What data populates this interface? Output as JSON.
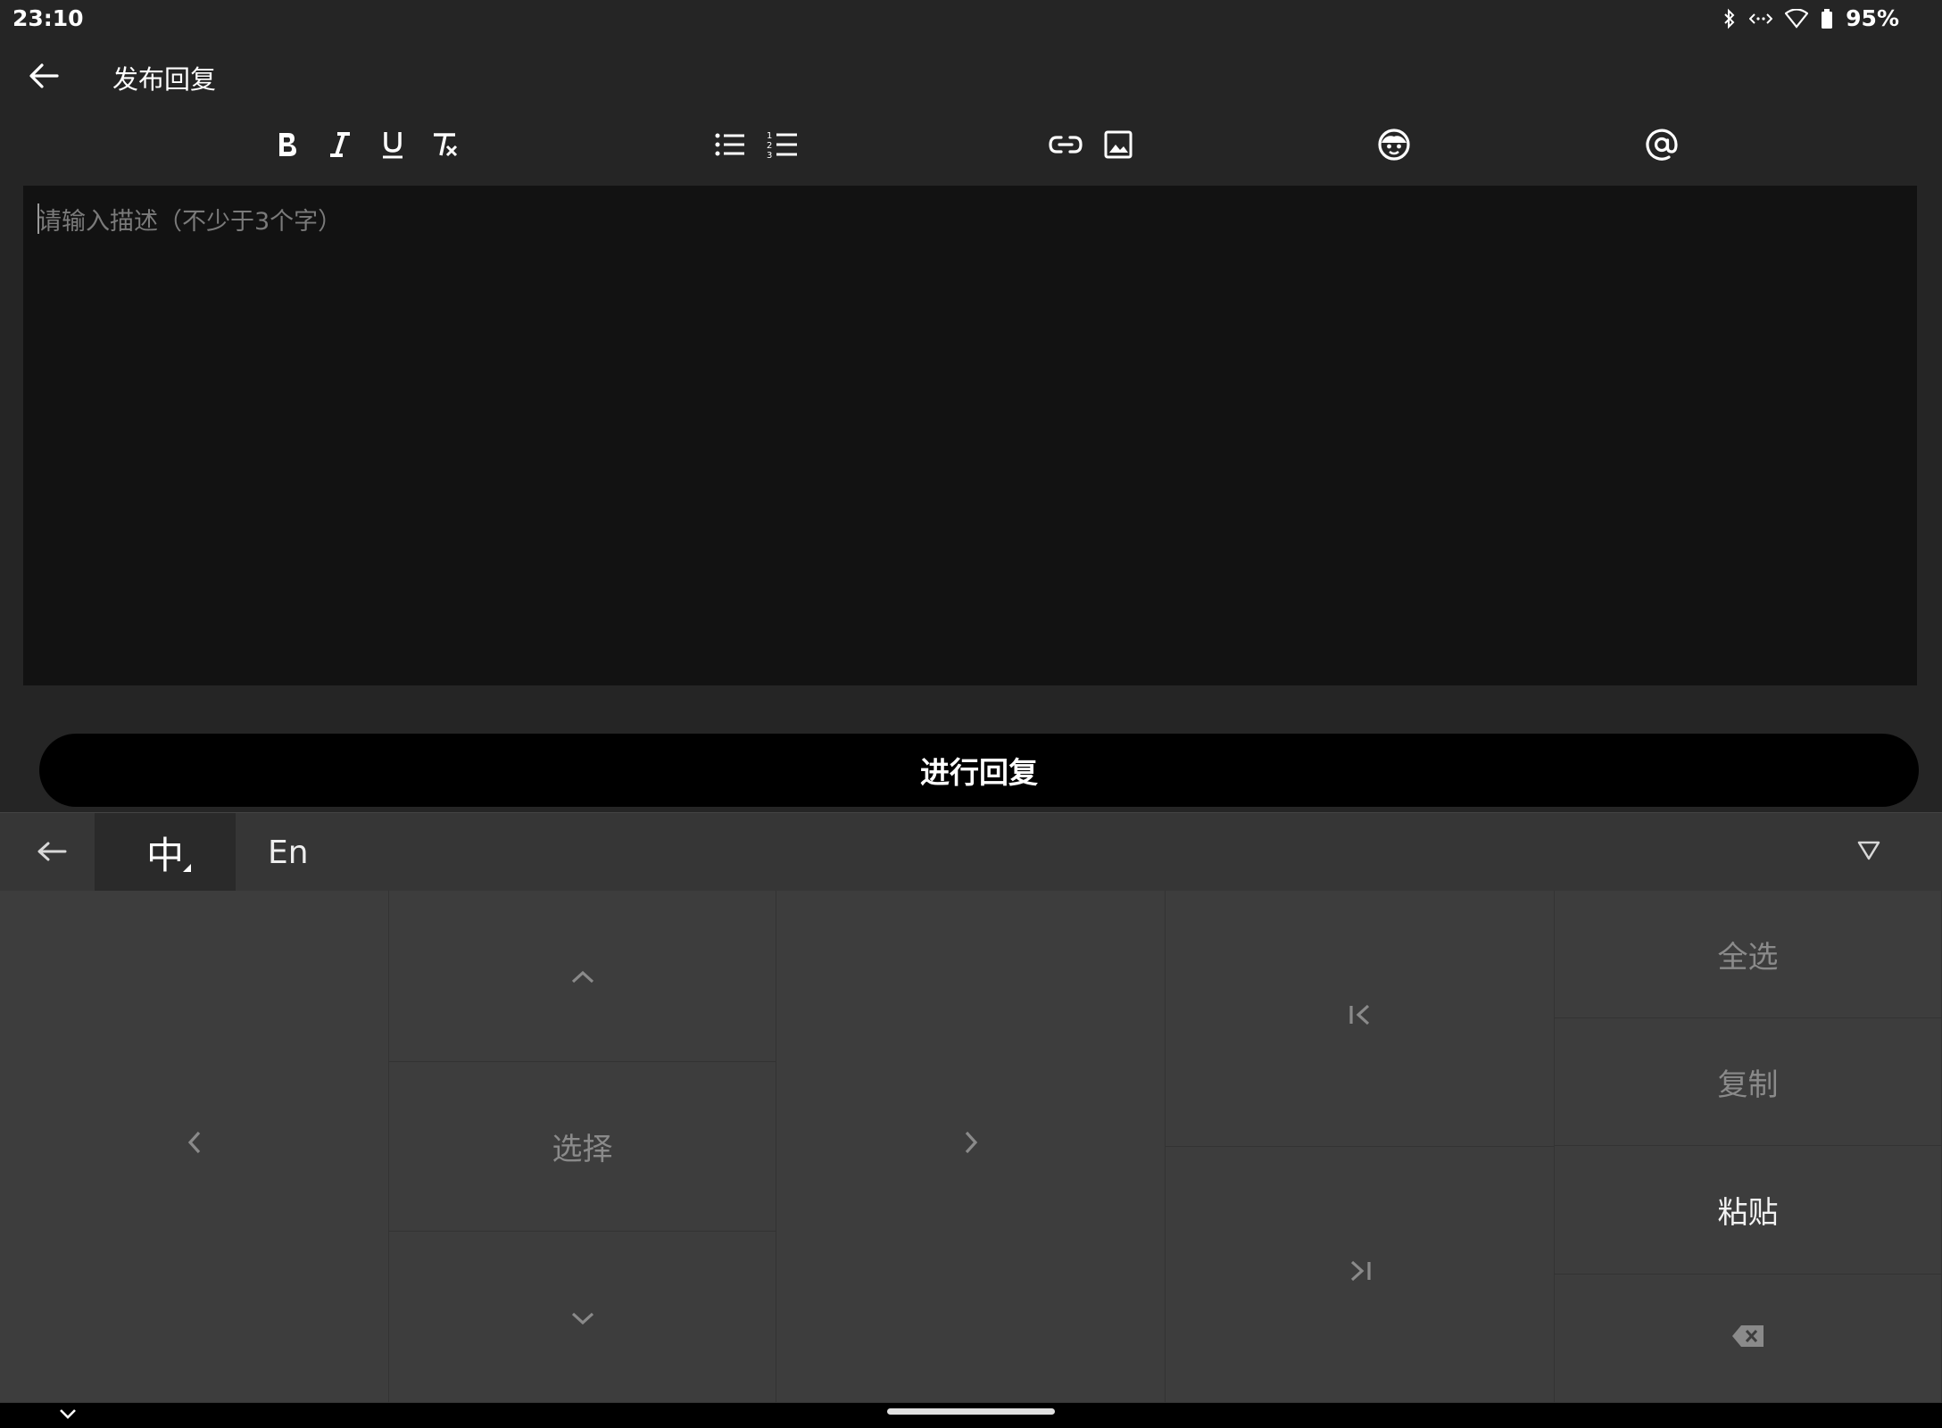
{
  "status": {
    "time": "23:10",
    "battery": "95%"
  },
  "appbar": {
    "title": "发布回复"
  },
  "toolbar": {
    "items": [
      "bold-icon",
      "italic-icon",
      "underline-icon",
      "clear-format-icon",
      "bullet-list-icon",
      "numbered-list-icon",
      "link-icon",
      "image-icon",
      "emoji-icon",
      "mention-icon"
    ]
  },
  "editor": {
    "placeholder": "请输入描述（不少于3个字）",
    "value": ""
  },
  "submit": {
    "label": "进行回复"
  },
  "keyboard": {
    "lang_zh": "中",
    "lang_en": "En",
    "select_label": "选择",
    "select_all": "全选",
    "copy": "复制",
    "paste": "粘贴"
  },
  "colors": {
    "background": "#252525",
    "editor_bg": "#121212",
    "button_bg": "#000000",
    "keyboard_bg": "#3d3d3d"
  }
}
